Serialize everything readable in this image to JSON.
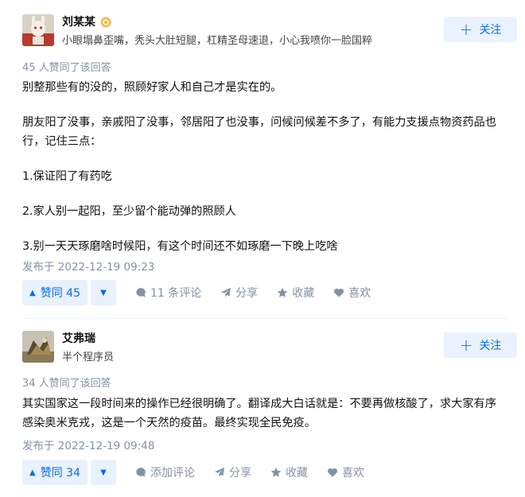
{
  "answers": [
    {
      "author_name": "刘某某",
      "author_bio": "小眼塌鼻歪嘴，秃头大肚短腿，杠精圣母速退，小心我喷你一脸国粹",
      "follow_label": "关注",
      "votes_text": "45 人赞同了该回答",
      "paragraphs": [
        "别整那些有的没的，照顾好家人和自己才是实在的。",
        "朋友阳了没事，亲戚阳了没事，邻居阳了也没事，问候问候差不多了，有能力支援点物资药品也行，记住三点：",
        "1.保证阳了有药吃",
        "2.家人别一起阳，至少留个能动弹的照顾人",
        "3.别一天天琢磨啥时候阳，有这个时间还不如琢磨一下晚上吃啥"
      ],
      "time_text": "发布于 2022-12-19 09:23",
      "upvote_label": "赞同 45",
      "comment_label": "11 条评论",
      "share_label": "分享",
      "favorite_label": "收藏",
      "like_label": "喜欢"
    },
    {
      "author_name": "艾弗瑞",
      "author_bio": "半个程序员",
      "follow_label": "关注",
      "votes_text": "34 人赞同了该回答",
      "paragraphs": [
        "其实国家这一段时间来的操作已经很明确了。翻译成大白话就是：不要再做核酸了，求大家有序感染奥米克戎，这是一个天然的疫苗。最终实现全民免疫。"
      ],
      "time_text": "发布于 2022-12-19 09:48",
      "upvote_label": "赞同 34",
      "comment_label": "添加评论",
      "share_label": "分享",
      "favorite_label": "收藏",
      "like_label": "喜欢"
    }
  ],
  "colors": {
    "accent": "#056de8",
    "accent_bg": "#eaf2ff",
    "meta_gray": "#8590a6"
  }
}
